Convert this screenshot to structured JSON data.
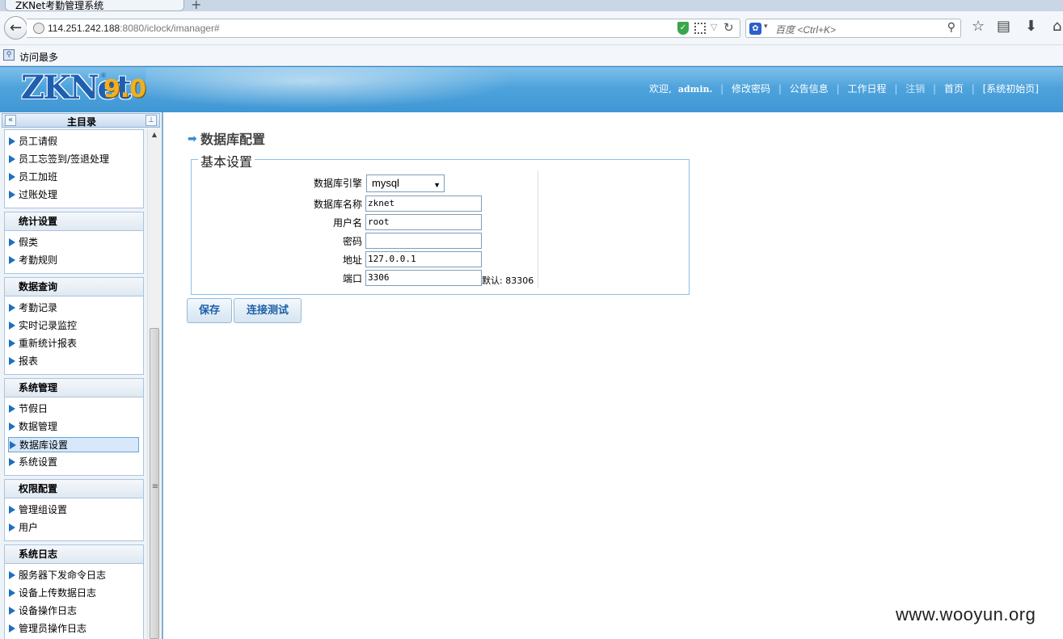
{
  "browser": {
    "tab_title": "ZKNet考勤管理系统",
    "new_tab": "+",
    "url_host": "114.251.242.188",
    "url_rest": ":8080/iclock/imanager#",
    "search_placeholder": "百度 <Ctrl+K>",
    "bookmark_most_visited": "访问最多"
  },
  "header": {
    "logo_text": "ZKNet",
    "logo_version": "9.0",
    "logo_reg": "®",
    "nav": {
      "welcome": "欢迎,",
      "user": "admin.",
      "change_password": "修改密码",
      "announcements": "公告信息",
      "work_schedule": "工作日程",
      "logout": "注销",
      "home": "首页",
      "init_home": "[系统初始页]"
    }
  },
  "sidebar": {
    "title": "主目录",
    "collapse_glyph": "«",
    "pin_glyph": "⊥",
    "top_items": [
      "员工请假",
      "员工忘签到/签退处理",
      "员工加班",
      "过账处理"
    ],
    "groups": [
      {
        "title": "统计设置",
        "items": [
          "假类",
          "考勤规则"
        ]
      },
      {
        "title": "数据查询",
        "items": [
          "考勤记录",
          "实时记录监控",
          "重新统计报表",
          "报表"
        ]
      },
      {
        "title": "系统管理",
        "items": [
          "节假日",
          "数据管理",
          "数据库设置",
          "系统设置"
        ]
      },
      {
        "title": "权限配置",
        "items": [
          "管理组设置",
          "用户"
        ]
      },
      {
        "title": "系统日志",
        "items": [
          "服务器下发命令日志",
          "设备上传数据日志",
          "设备操作日志",
          "管理员操作日志"
        ]
      }
    ],
    "active_item": "数据库设置"
  },
  "main": {
    "page_title": "数据库配置",
    "fieldset_legend": "基本设置",
    "fields": {
      "engine": {
        "label": "数据库引擎",
        "value": "mysql"
      },
      "db_name": {
        "label": "数据库名称",
        "value": "zknet"
      },
      "username": {
        "label": "用户名",
        "value": "root"
      },
      "password": {
        "label": "密码",
        "value": ""
      },
      "address": {
        "label": "地址",
        "value": "127.0.0.1"
      },
      "port": {
        "label": "端口",
        "value": "3306",
        "hint": "默认: 83306"
      }
    },
    "buttons": {
      "save": "保存",
      "test": "连接测试"
    }
  },
  "watermark": "www.wooyun.org",
  "colors": {
    "header_blue": "#4ea3dc",
    "link_blue": "#1d5fa8",
    "accent_orange": "#f2b01e"
  }
}
